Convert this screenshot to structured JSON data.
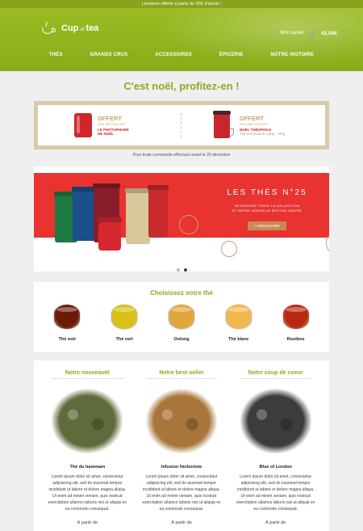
{
  "top_strip": {
    "text": "Livraison offerte à partir de 65€ d'achat !"
  },
  "brand": {
    "name_part1": "Cup",
    "name_of": "of",
    "name_part2": "tea"
  },
  "cart": {
    "label": "Mon panier",
    "icon": "cart-icon",
    "amount": "42,00€"
  },
  "nav": {
    "items": [
      "THÉS",
      "GRANDS CRUS",
      "ACCESSOIRES",
      "ÉPICERIE",
      "NOTRE HISTOIRE"
    ]
  },
  "headline": "C'est noël, profitez-en !",
  "offer": {
    "left": {
      "title": "OFFERT",
      "condition": "DÈS 65€ D'ACHAT*",
      "product": "LE PHOTOPHORE",
      "product2": "DE NOËL"
    },
    "right": {
      "title": "OFFERT",
      "condition": "DÈS 85€ D'ACHAT*",
      "product": "NOËL THÉOPHILE",
      "detail": "Thé vert prune & orang - 100g"
    },
    "note": "Pour toute commande effectuée avant le 20 décembre"
  },
  "banner": {
    "title": "LES THÉS N°25",
    "line1": "RETROUVEZ TOUTE LA COLLECTION",
    "line2": "ET NOTRE NOUVELLE ÉDITION LIMITÉE",
    "button": "> DÉCOUVRIR",
    "slide_count": 2,
    "active_slide": 2
  },
  "choose": {
    "title": "Choisissez votre thé",
    "teas": [
      {
        "label": "Thé noir",
        "color": "#6b1a06"
      },
      {
        "label": "Thé vert",
        "color": "#d9c012"
      },
      {
        "label": "Oolong",
        "color": "#e0a53a"
      },
      {
        "label": "Thé blanc",
        "color": "#f0b84a"
      },
      {
        "label": "Rooibos",
        "color": "#b8280f"
      }
    ]
  },
  "products": [
    {
      "section": "Notre nouveauté",
      "name": "Thé du hammam",
      "desc": "Lorem ipsum dolor sit amet, consectetur adipisicing elit, sed do eiusmod tempor incididunt ut labore et dolore magna aliqua. Ut enim ad minim veniam, quis nostrud exercitation ullamco laboris nisi ut aliquip ex ea commodo consequat.",
      "from": "À partir de",
      "leaf_color": "#5e6b3a"
    },
    {
      "section": "Notre best-seller",
      "name": "Infusion Herboriste",
      "desc": "Lorem ipsum dolor sit amet, consectetur adipisicing elit, sed do eiusmod tempor incididunt ut labore et dolore magna aliqua. Ut enim ad minim veniam, quis nostrud exercitation ullamco laboris nisi ut aliquip ex ea commodo consequat.",
      "from": "À partir de",
      "leaf_color": "#a8753a"
    },
    {
      "section": "Notre coup de coeur",
      "name": "Blue of London",
      "desc": "Lorem ipsum dolor sit amet, consectetur adipisicing elit, sed do eiusmod tempor incididunt ut labore et dolore magna aliqua. Ut enim ad minim veniam, quis nostrud exercitation ullamco laboris nisi ut aliquip ex ea commodo consequat.",
      "from": "À partir de",
      "leaf_color": "#3b3d3a"
    }
  ]
}
